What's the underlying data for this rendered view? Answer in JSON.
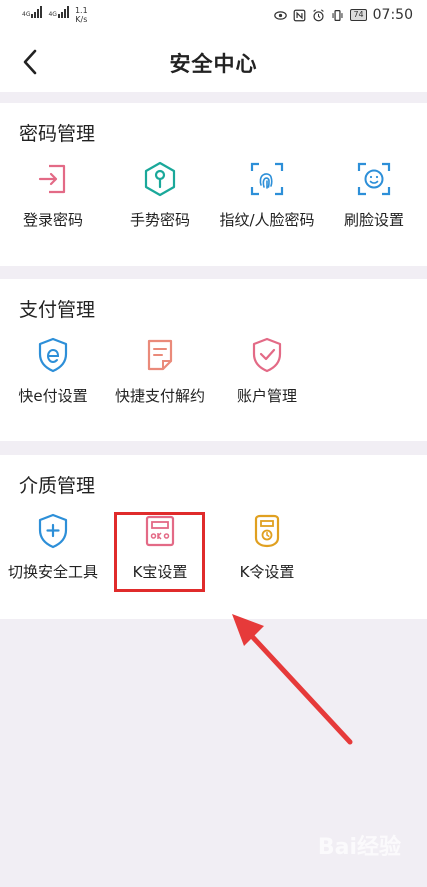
{
  "status_bar": {
    "net1": "4G",
    "net2": "4G",
    "speed_value": "1.1",
    "speed_unit": "K/s",
    "battery": "74",
    "time": "07:50",
    "icons": [
      "eye-icon",
      "nfc-icon",
      "alarm-icon",
      "vibrate-icon"
    ]
  },
  "header": {
    "title": "安全中心",
    "back_icon": "chevron-left-icon"
  },
  "sections": [
    {
      "title": "密码管理",
      "items": [
        {
          "label": "登录密码",
          "icon": "login-icon",
          "color": "#e36a86"
        },
        {
          "label": "手势密码",
          "icon": "gesture-icon",
          "color": "#1aa89a"
        },
        {
          "label": "指纹/人脸密码",
          "icon": "fingerprint-icon",
          "color": "#2d8fd8"
        },
        {
          "label": "刷脸设置",
          "icon": "face-scan-icon",
          "color": "#2d8fd8"
        }
      ]
    },
    {
      "title": "支付管理",
      "items": [
        {
          "label": "快e付设置",
          "icon": "e-pay-shield-icon",
          "color": "#2d8fd8"
        },
        {
          "label": "快捷支付解约",
          "icon": "document-icon",
          "color": "#ea8a7a"
        },
        {
          "label": "账户管理",
          "icon": "shield-check-icon",
          "color": "#e36a86"
        }
      ]
    },
    {
      "title": "介质管理",
      "items": [
        {
          "label": "切换安全工具",
          "icon": "shield-plus-icon",
          "color": "#2d8fd8"
        },
        {
          "label": "K宝设置",
          "icon": "k-token-icon",
          "color": "#e36a86"
        },
        {
          "label": "K令设置",
          "icon": "k-code-token-icon",
          "color": "#e0a020"
        }
      ]
    }
  ],
  "annotation": {
    "highlight_color": "#e02b2b",
    "arrow_color": "#e63a3a"
  },
  "watermark": "Bai经验"
}
